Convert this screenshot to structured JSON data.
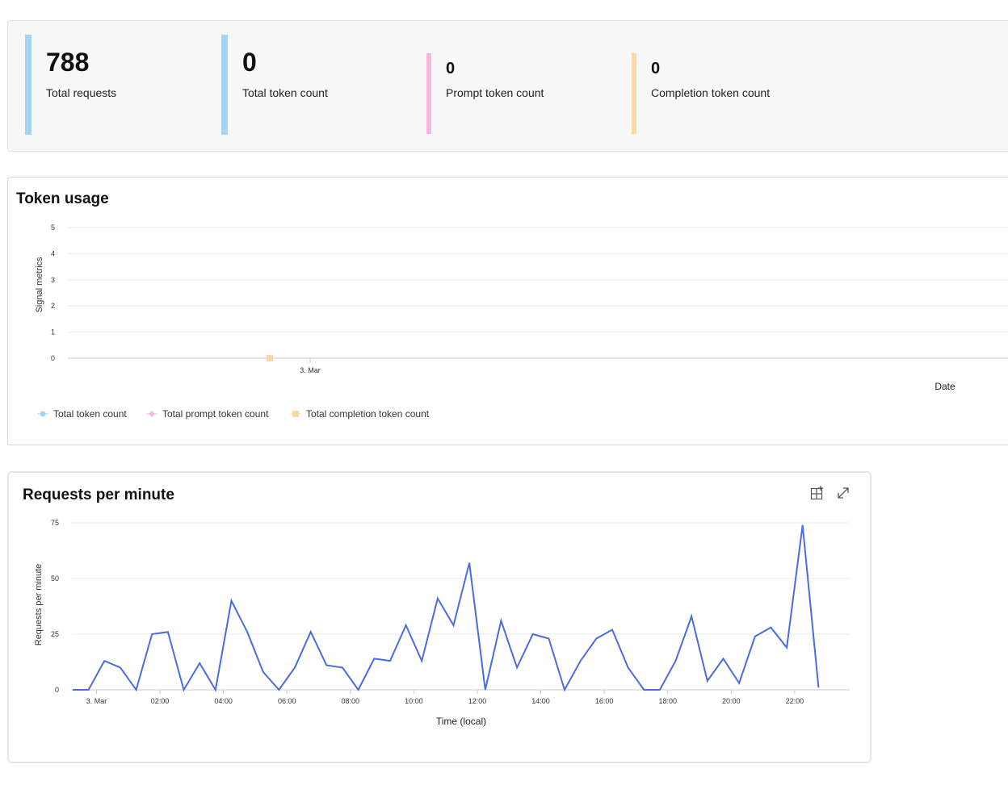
{
  "metrics": [
    {
      "value": "788",
      "label": "Total requests",
      "color": "#a7d3f3"
    },
    {
      "value": "0",
      "label": "Total token count",
      "color": "#a7d3f3"
    },
    {
      "value": "0",
      "label": "Prompt token count",
      "color": "#f6b6e0"
    },
    {
      "value": "0",
      "label": "Completion token count",
      "color": "#fbd9a6"
    }
  ],
  "token_usage": {
    "title": "Token usage",
    "x_title": "Date",
    "legend": [
      {
        "label": "Total token count",
        "color": "#a7d3f3",
        "marker": "circle"
      },
      {
        "label": "Total prompt token count",
        "color": "#f6b6e0",
        "marker": "diamond"
      },
      {
        "label": "Total completion token count",
        "color": "#fbd9a6",
        "marker": "square"
      }
    ]
  },
  "requests_card": {
    "title": "Requests per minute",
    "add_icon": "add-to-dashboard-icon",
    "expand_icon": "expand-icon"
  },
  "chart_data": [
    {
      "type": "line",
      "title": "Token usage",
      "xlabel": "Date",
      "ylabel": "Signal metrics",
      "ylim": [
        0,
        5
      ],
      "yticks": [
        0,
        1,
        2,
        3,
        4,
        5
      ],
      "xticks": [
        "3. Mar"
      ],
      "series": [
        {
          "name": "Total token count",
          "color": "#a7d3f3",
          "x": [
            "3. Mar"
          ],
          "values": [
            0
          ]
        },
        {
          "name": "Total prompt token count",
          "color": "#f6b6e0",
          "x": [
            "3. Mar"
          ],
          "values": [
            0
          ]
        },
        {
          "name": "Total completion token count",
          "color": "#fbd9a6",
          "x": [
            "3. Mar"
          ],
          "values": [
            0
          ]
        }
      ],
      "grid": true,
      "legend": "bottom-left"
    },
    {
      "type": "line",
      "title": "Requests per minute",
      "xlabel": "Time (local)",
      "ylabel": "Requests per minute",
      "ylim": [
        0,
        75
      ],
      "yticks": [
        0,
        25,
        50,
        75
      ],
      "xlim": [
        -0.75,
        23.25
      ],
      "xticks": [
        {
          "x": 0,
          "label": "3. Mar"
        },
        {
          "x": 2,
          "label": "02:00"
        },
        {
          "x": 4,
          "label": "04:00"
        },
        {
          "x": 6,
          "label": "06:00"
        },
        {
          "x": 8,
          "label": "08:00"
        },
        {
          "x": 10,
          "label": "10:00"
        },
        {
          "x": 12,
          "label": "12:00"
        },
        {
          "x": 14,
          "label": "14:00"
        },
        {
          "x": 16,
          "label": "16:00"
        },
        {
          "x": 18,
          "label": "18:00"
        },
        {
          "x": 20,
          "label": "20:00"
        },
        {
          "x": 22,
          "label": "22:00"
        }
      ],
      "series": [
        {
          "color": "#4a6cde",
          "x": [
            -0.75,
            -0.25,
            0.25,
            0.75,
            1.25,
            1.75,
            2.25,
            2.75,
            3.25,
            3.75,
            4.25,
            4.75,
            5.25,
            5.75,
            6.25,
            6.75,
            7.25,
            7.75,
            8.25,
            8.75,
            9.25,
            9.75,
            10.25,
            10.75,
            11.25,
            11.75,
            12.25,
            12.75,
            13.25,
            13.75,
            14.25,
            14.75,
            15.25,
            15.75,
            16.25,
            16.75,
            17.25,
            17.75,
            18.25,
            18.75,
            19.25,
            19.75,
            20.25,
            20.75,
            21.25,
            21.75,
            22.25,
            22.75
          ],
          "values": [
            0,
            0,
            13,
            10,
            0,
            25,
            26,
            0,
            12,
            0,
            40,
            26,
            8,
            0,
            10,
            26,
            11,
            10,
            0,
            14,
            13,
            29,
            13,
            41,
            29,
            57,
            0,
            31,
            10,
            25,
            23,
            0,
            13,
            23,
            27,
            10,
            0,
            0,
            13,
            33,
            4,
            14,
            3,
            24,
            28,
            19,
            74,
            1
          ]
        }
      ],
      "grid": true
    }
  ]
}
